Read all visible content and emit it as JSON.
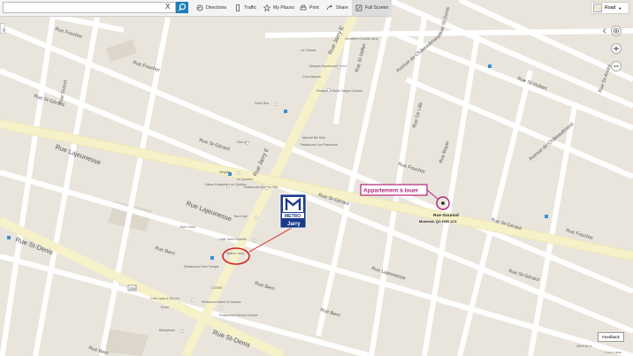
{
  "toolbar": {
    "search_placeholder": "",
    "clear_label": "X",
    "items": [
      {
        "label": "Directions",
        "icon": "directions-icon"
      },
      {
        "label": "Traffic",
        "icon": "traffic-icon"
      },
      {
        "label": "My Places",
        "icon": "star-icon"
      },
      {
        "label": "Print",
        "icon": "print-icon"
      },
      {
        "label": "Share",
        "icon": "share-icon"
      },
      {
        "label": "Full Screen",
        "icon": "fullscreen-icon"
      }
    ],
    "map_style": "Road"
  },
  "streets": {
    "rue_foucher_1": "Rue Foucher",
    "rue_foucher_2": "Rue Foucher",
    "rue_foucher_3": "Rue Foucher",
    "rue_foucher_4": "Rue Foucher",
    "rue_st_gerard_1": "Rue St-Gérard",
    "rue_st_gerard_2": "Rue St-Gérard",
    "rue_st_gerard_3": "Rue St-Gérard",
    "rue_st_gerard_4": "Rue St-Gérard",
    "rue_st_gerard_5": "Rue St-Gérard",
    "rue_lajeunesse_1": "Rue Lajeunesse",
    "rue_lajeunesse_2": "Rue Lajeunesse",
    "rue_lajeunesse_3": "Rue Lajeunesse",
    "rue_st_denis_1": "Rue St-Denis",
    "rue_st_denis_2": "Rue St-Denis",
    "rue_berri_1": "Rue Berri",
    "rue_berri_2": "Rue Berri",
    "rue_berri_3": "Rue Berri",
    "rue_berri_4": "Rue Berri",
    "rue_jarry_e_1": "Rue Jarry E",
    "rue_jarry_e_2": "Rue Jarry E",
    "rue_guizot": "Rue Guizot",
    "rue_st_hubert": "Rue St-Hubert",
    "rue_st_andre": "Rue St-André",
    "rue_st_vallier": "Rue St-Vallier",
    "rue_de_lille": "Rue De Lille",
    "av_chateaubriand_1": "Avenue de Châteaubriand",
    "av_chateaubriand_2": "Avenue de Châteaubriand",
    "rue_boyer": "Rue Boyer",
    "rue_st_denis_left": "Rue St-Denis"
  },
  "pois": {
    "la_cabane": "La Cabane",
    "cimetiere": "Cimetière Comblé Jarry",
    "marquis": "Marquis Superbourbon Inc",
    "chez_maman": "Chez Maman",
    "restaurant_boite": "Restaurant Boite Saigon Cuisine",
    "sushi_bon": "Sushi Bon",
    "marche_bio": "Marché Bio Mila",
    "restaurant_pho": "Restaurant Lao Pasadena",
    "dia_latin": "Dia Latin",
    "megabx": "Mégabx",
    "le_quartier": "Le Quartier",
    "caisse": "Caisse Desjardins du Québec",
    "restaurant_quebec": "Restaurant Quebec Viet",
    "bon_kopi": "Bon Kopi",
    "jean_coutu": "Jean Coutu",
    "cafe_saint": "Café Saint Michelle",
    "station_jarry": "Station Jarry",
    "restaurant_chez": "Restaurant Chez Temple",
    "lggbs": "LGGBS",
    "cafe_lysta": "Café Lysta & Kilo Inc",
    "rezer": "Rezer",
    "restaurant_bank": "Restaurant Bank of Canada",
    "restaurant_chinois": "Restaurant Chinois Cuisine",
    "bellepharm": "Bellepharm",
    "route_335": "335"
  },
  "annotation": {
    "label": "Appartement à louer",
    "address_line1": "Rue Gounod",
    "address_line2": "Montreal, QC H2R 1C3",
    "metro_brand": "METRO",
    "metro_station": "Jarry",
    "accent_color": "#b3227e",
    "metro_color": "#1a3a8c",
    "circle_color": "#d42323"
  },
  "controls": {
    "feedback_label": "Feedback",
    "scale_text": "200 ft   50 m",
    "copyright": "© 2017 HERE"
  }
}
